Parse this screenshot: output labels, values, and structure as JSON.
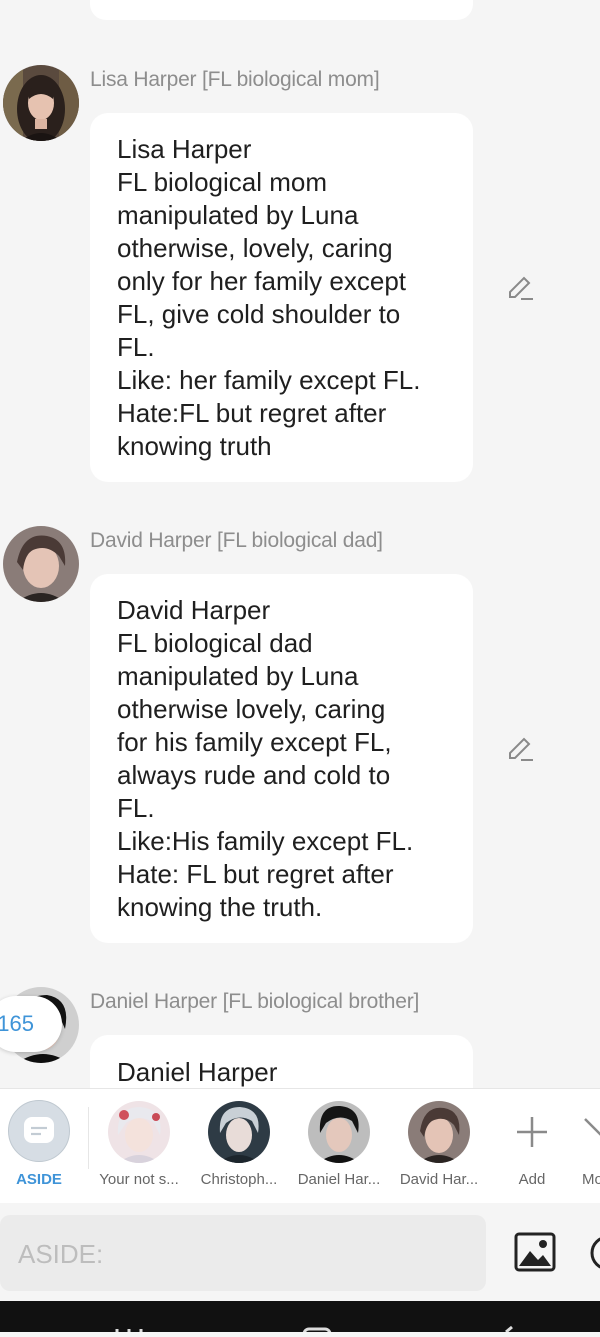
{
  "messages": [
    {
      "name": "Lisa Harper [FL biological mom]",
      "lines": [
        "Lisa Harper",
        "FL biological mom",
        "manipulated by Luna",
        "otherwise, lovely, caring",
        "only for her family except",
        "FL, give cold shoulder to",
        "FL.",
        "Like: her family except FL.",
        "Hate:FL but regret after",
        "knowing truth"
      ],
      "avatar_colors": [
        "#3a2e2a",
        "#c89a84"
      ]
    },
    {
      "name": "David Harper [FL biological dad]",
      "lines": [
        "David Harper",
        "FL biological dad",
        "manipulated by Luna",
        "otherwise lovely, caring",
        "for his family except FL,",
        "always rude and cold to",
        "FL.",
        "Like:His family except FL.",
        "Hate: FL but regret after",
        "knowing the truth."
      ],
      "avatar_colors": [
        "#4a3a36",
        "#d8b3a4"
      ]
    },
    {
      "name": "Daniel Harper [FL biological brother]",
      "lines": [
        "Daniel Harper"
      ],
      "avatar_colors": [
        "#1c1c1c",
        "#e2c9bf"
      ]
    }
  ],
  "counter": "165",
  "characters": [
    {
      "label": "ASIDE",
      "icon": "chat-bubble-icon",
      "active": true
    },
    {
      "label": "Your not s...",
      "icon": "avatar",
      "colors": [
        "#e8d6d8",
        "#c9505a"
      ]
    },
    {
      "label": "Christoph...",
      "icon": "avatar",
      "colors": [
        "#2e3b45",
        "#c8d0d6"
      ]
    },
    {
      "label": "Daniel Har...",
      "icon": "avatar",
      "colors": [
        "#151515",
        "#d9c0b5"
      ]
    },
    {
      "label": "David Har...",
      "icon": "avatar",
      "colors": [
        "#4a3a36",
        "#d8b3a4"
      ]
    },
    {
      "label": "Add",
      "icon": "plus-icon"
    },
    {
      "label": "Mo",
      "icon": "chevron-icon"
    }
  ],
  "input": {
    "placeholder": "ASIDE:"
  },
  "colors": {
    "accent": "#3f94d8",
    "bubble": "#ffffff",
    "background": "#f5f5f5"
  }
}
